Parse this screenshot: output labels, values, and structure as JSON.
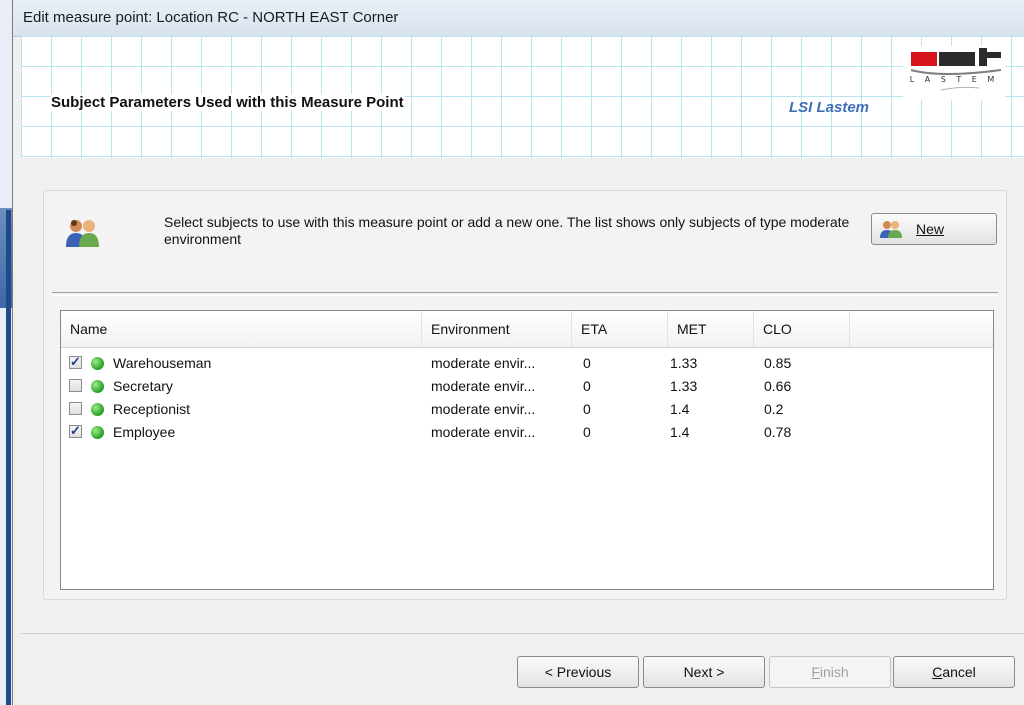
{
  "window": {
    "title": "Edit measure point: Location RC - NORTH EAST Corner"
  },
  "header": {
    "title": "Subject Parameters Used with this Measure Point",
    "brand": "LSI Lastem",
    "logo_text": "LSI LASTEM"
  },
  "info": {
    "text": "Select subjects to use with this measure point or add a new one. The list shows only subjects of type moderate environment",
    "icon": "users-icon"
  },
  "new_button": {
    "label": "New",
    "icon": "add-users-icon"
  },
  "table": {
    "columns": [
      "Name",
      "Environment",
      "ETA",
      "MET",
      "CLO"
    ],
    "rows": [
      {
        "checked": true,
        "name": "Warehouseman",
        "environment": "moderate envir...",
        "eta": "0",
        "met": "1.33",
        "clo": "0.85"
      },
      {
        "checked": false,
        "name": "Secretary",
        "environment": "moderate envir...",
        "eta": "0",
        "met": "1.33",
        "clo": "0.66"
      },
      {
        "checked": false,
        "name": "Receptionist",
        "environment": "moderate envir...",
        "eta": "0",
        "met": "1.4",
        "clo": "0.2"
      },
      {
        "checked": true,
        "name": "Employee",
        "environment": "moderate envir...",
        "eta": "0",
        "met": "1.4",
        "clo": "0.78"
      }
    ],
    "status_color": "#2aa42b"
  },
  "footer": {
    "previous": "< Previous",
    "next": "Next >",
    "finish_prefix": "",
    "finish_letter": "F",
    "finish_rest": "inish",
    "cancel_letter": "C",
    "cancel_rest": "ancel"
  },
  "colors": {
    "accent": "#3f6fb8",
    "grid_line": "#b9e6ee"
  }
}
